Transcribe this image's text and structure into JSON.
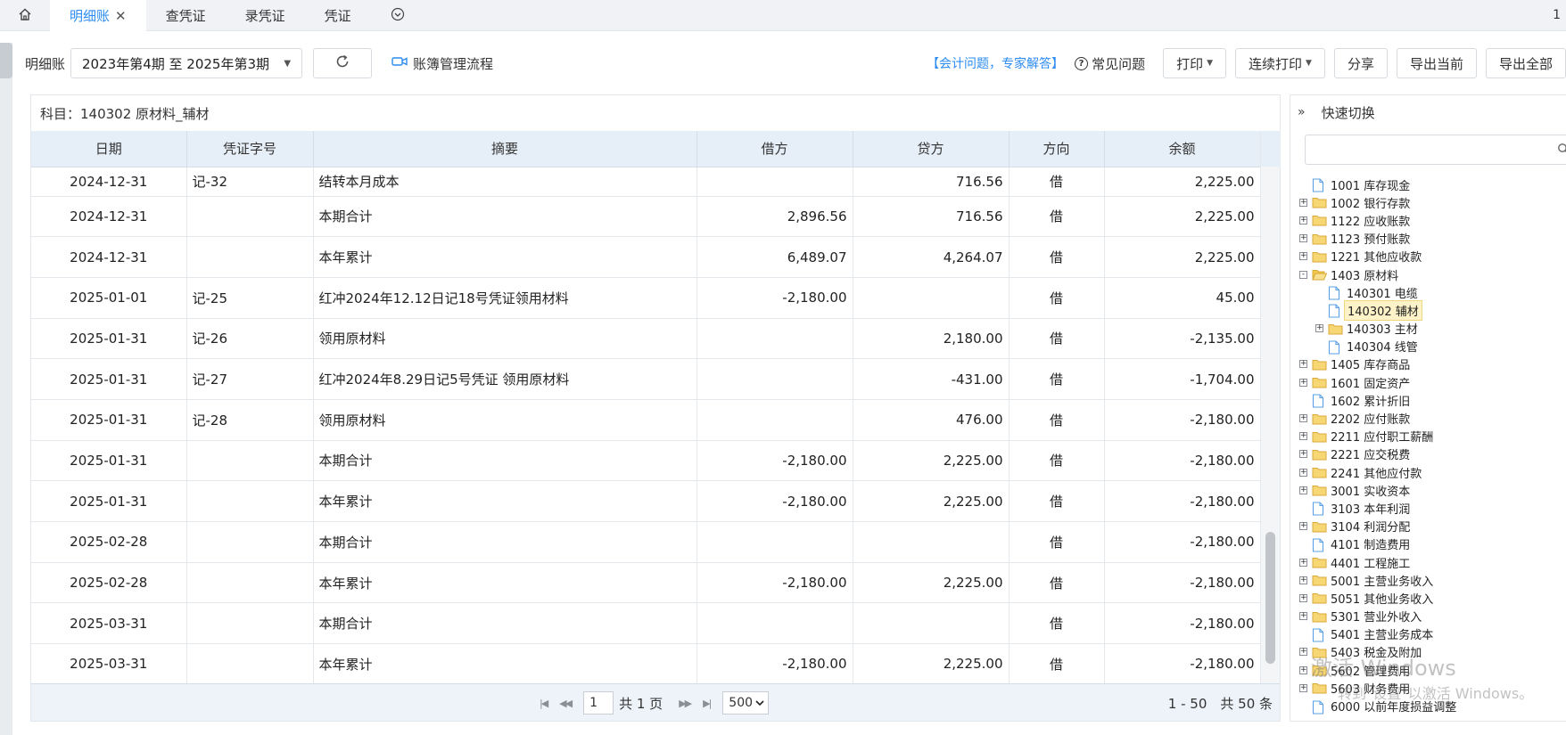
{
  "tabs": [
    {
      "label": "",
      "icon": "home-icon"
    },
    {
      "label": "明细账",
      "active": true,
      "closable": true
    },
    {
      "label": "查凭证"
    },
    {
      "label": "录凭证"
    },
    {
      "label": "凭证"
    },
    {
      "label": "",
      "icon": "chevron-circle-down-icon"
    }
  ],
  "tabbar_right": "1",
  "toolbar": {
    "ledger_label": "明细账",
    "period_value": "2023年第4期 至 2025年第3期",
    "flow_link": "账簿管理流程",
    "expert_link": "【会计问题，专家解答】",
    "faq": "常见问题",
    "print": "打印",
    "batch_print": "连续打印",
    "share": "分享",
    "export_current": "导出当前",
    "export_all": "导出全部"
  },
  "subject": "科目：140302 原材料_辅材",
  "grid": {
    "headers": [
      "日期",
      "凭证字号",
      "摘要",
      "借方",
      "贷方",
      "方向",
      "余额"
    ],
    "rows": [
      {
        "date": "2024-12-31",
        "voucher": "记-32",
        "summary": "结转本月成本",
        "debit": "",
        "credit": "716.56",
        "dir": "借",
        "balance": "2,225.00"
      },
      {
        "date": "2024-12-31",
        "voucher": "",
        "summary": "本期合计",
        "debit": "2,896.56",
        "credit": "716.56",
        "dir": "借",
        "balance": "2,225.00"
      },
      {
        "date": "2024-12-31",
        "voucher": "",
        "summary": "本年累计",
        "debit": "6,489.07",
        "credit": "4,264.07",
        "dir": "借",
        "balance": "2,225.00"
      },
      {
        "date": "2025-01-01",
        "voucher": "记-25",
        "summary": "红冲2024年12.12日记18号凭证领用材料",
        "debit": "-2,180.00",
        "credit": "",
        "dir": "借",
        "balance": "45.00"
      },
      {
        "date": "2025-01-31",
        "voucher": "记-26",
        "summary": "领用原材料",
        "debit": "",
        "credit": "2,180.00",
        "dir": "借",
        "balance": "-2,135.00"
      },
      {
        "date": "2025-01-31",
        "voucher": "记-27",
        "summary": "红冲2024年8.29日记5号凭证 领用原材料",
        "debit": "",
        "credit": "-431.00",
        "dir": "借",
        "balance": "-1,704.00"
      },
      {
        "date": "2025-01-31",
        "voucher": "记-28",
        "summary": "领用原材料",
        "debit": "",
        "credit": "476.00",
        "dir": "借",
        "balance": "-2,180.00"
      },
      {
        "date": "2025-01-31",
        "voucher": "",
        "summary": "本期合计",
        "debit": "-2,180.00",
        "credit": "2,225.00",
        "dir": "借",
        "balance": "-2,180.00"
      },
      {
        "date": "2025-01-31",
        "voucher": "",
        "summary": "本年累计",
        "debit": "-2,180.00",
        "credit": "2,225.00",
        "dir": "借",
        "balance": "-2,180.00"
      },
      {
        "date": "2025-02-28",
        "voucher": "",
        "summary": "本期合计",
        "debit": "",
        "credit": "",
        "dir": "借",
        "balance": "-2,180.00"
      },
      {
        "date": "2025-02-28",
        "voucher": "",
        "summary": "本年累计",
        "debit": "-2,180.00",
        "credit": "2,225.00",
        "dir": "借",
        "balance": "-2,180.00"
      },
      {
        "date": "2025-03-31",
        "voucher": "",
        "summary": "本期合计",
        "debit": "",
        "credit": "",
        "dir": "借",
        "balance": "-2,180.00"
      },
      {
        "date": "2025-03-31",
        "voucher": "",
        "summary": "本年累计",
        "debit": "-2,180.00",
        "credit": "2,225.00",
        "dir": "借",
        "balance": "-2,180.00"
      }
    ]
  },
  "pager": {
    "page": "1",
    "total_pages": "共 1 页",
    "page_size": "500",
    "range": "1 - 50　共 50 条"
  },
  "side": {
    "title": "快速切换",
    "search_placeholder": "",
    "tree": [
      {
        "label": "1001 库存现金",
        "type": "file",
        "level": 0,
        "expander": ""
      },
      {
        "label": "1002 银行存款",
        "type": "folder",
        "level": 0,
        "expander": "+"
      },
      {
        "label": "1122 应收账款",
        "type": "folder",
        "level": 0,
        "expander": "+"
      },
      {
        "label": "1123 预付账款",
        "type": "folder",
        "level": 0,
        "expander": "+"
      },
      {
        "label": "1221 其他应收款",
        "type": "folder",
        "level": 0,
        "expander": "+"
      },
      {
        "label": "1403 原材料",
        "type": "folder-open",
        "level": 0,
        "expander": "-"
      },
      {
        "label": "140301 电缆",
        "type": "file",
        "level": 1,
        "expander": ""
      },
      {
        "label": "140302 辅材",
        "type": "file",
        "level": 1,
        "expander": "",
        "selected": true
      },
      {
        "label": "140303 主材",
        "type": "folder",
        "level": 1,
        "expander": "+"
      },
      {
        "label": "140304 线管",
        "type": "file",
        "level": 1,
        "expander": ""
      },
      {
        "label": "1405 库存商品",
        "type": "folder",
        "level": 0,
        "expander": "+"
      },
      {
        "label": "1601 固定资产",
        "type": "folder",
        "level": 0,
        "expander": "+"
      },
      {
        "label": "1602 累计折旧",
        "type": "file",
        "level": 0,
        "expander": ""
      },
      {
        "label": "2202 应付账款",
        "type": "folder",
        "level": 0,
        "expander": "+"
      },
      {
        "label": "2211 应付职工薪酬",
        "type": "folder",
        "level": 0,
        "expander": "+"
      },
      {
        "label": "2221 应交税费",
        "type": "folder",
        "level": 0,
        "expander": "+"
      },
      {
        "label": "2241 其他应付款",
        "type": "folder",
        "level": 0,
        "expander": "+"
      },
      {
        "label": "3001 实收资本",
        "type": "folder",
        "level": 0,
        "expander": "+"
      },
      {
        "label": "3103 本年利润",
        "type": "file",
        "level": 0,
        "expander": ""
      },
      {
        "label": "3104 利润分配",
        "type": "folder",
        "level": 0,
        "expander": "+"
      },
      {
        "label": "4101 制造费用",
        "type": "file",
        "level": 0,
        "expander": ""
      },
      {
        "label": "4401 工程施工",
        "type": "folder",
        "level": 0,
        "expander": "+"
      },
      {
        "label": "5001 主营业务收入",
        "type": "folder",
        "level": 0,
        "expander": "+"
      },
      {
        "label": "5051 其他业务收入",
        "type": "folder",
        "level": 0,
        "expander": "+"
      },
      {
        "label": "5301 营业外收入",
        "type": "folder",
        "level": 0,
        "expander": "+"
      },
      {
        "label": "5401 主营业务成本",
        "type": "file",
        "level": 0,
        "expander": ""
      },
      {
        "label": "5403 税金及附加",
        "type": "folder",
        "level": 0,
        "expander": "+"
      },
      {
        "label": "5602 管理费用",
        "type": "folder",
        "level": 0,
        "expander": "+"
      },
      {
        "label": "5603 财务费用",
        "type": "folder",
        "level": 0,
        "expander": "+"
      },
      {
        "label": "6000 以前年度损益调整",
        "type": "file",
        "level": 0,
        "expander": ""
      }
    ]
  },
  "watermark": {
    "line1": "激活 Windows",
    "line2": "转到\"设置\"以激活 Windows。"
  },
  "colors": {
    "accent": "#2d8cf0",
    "header_bg": "#e6eef7",
    "tabbar_bg": "#f0f2f5",
    "selected_bg": "#fdf2c8"
  }
}
